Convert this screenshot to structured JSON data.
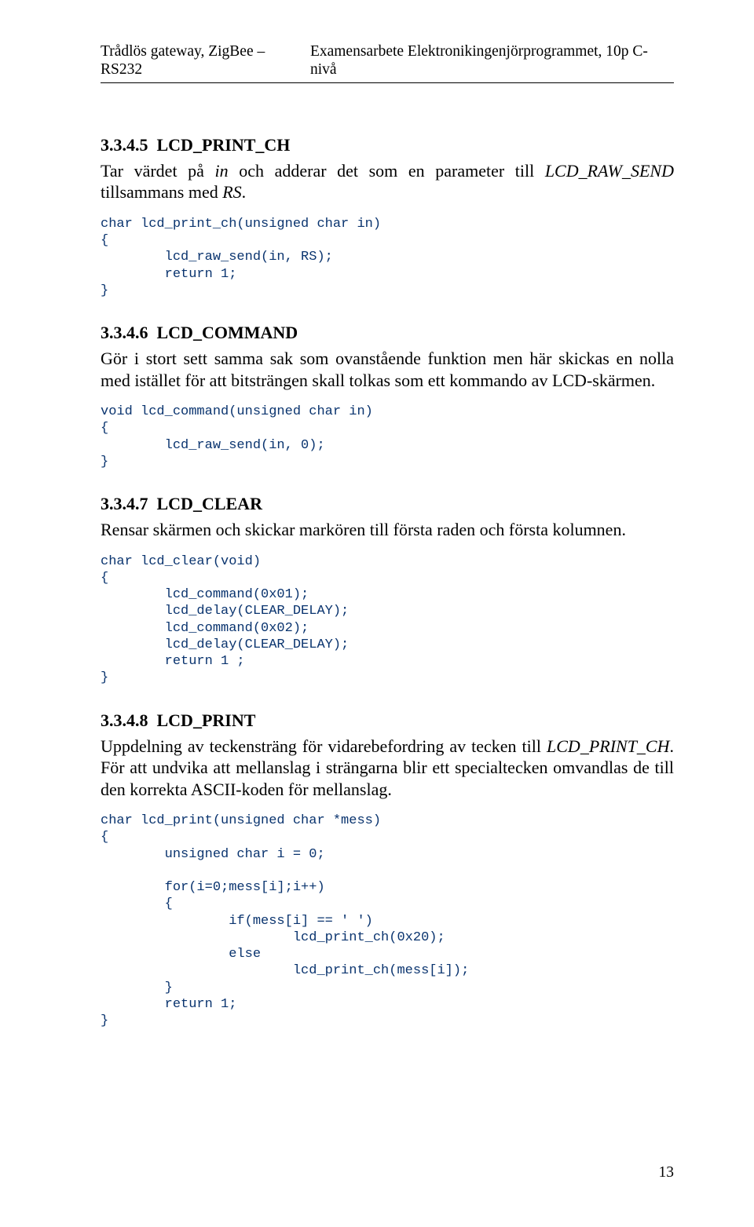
{
  "header": {
    "left": "Trådlös gateway, ZigBee – RS232",
    "right": "Examensarbete Elektronikingenjörprogrammet, 10p C-nivå"
  },
  "sections": [
    {
      "number": "3.3.4.5",
      "title": "LCD_PRINT_CH",
      "para_html": "Tar värdet på <i>in</i> och adderar det som en parameter till <i>LCD_RAW_SEND</i> tillsammans med <i>RS</i>.",
      "code": "char lcd_print_ch(unsigned char in)\n{\n        lcd_raw_send(in, RS);\n        return 1;\n}"
    },
    {
      "number": "3.3.4.6",
      "title": "LCD_COMMAND",
      "para_html": "Gör i stort sett samma sak som ovanstående funktion men här skickas en nolla med istället för att bitsträngen skall tolkas som ett kommando av LCD-skärmen.",
      "code": "void lcd_command(unsigned char in)\n{\n        lcd_raw_send(in, 0);\n}"
    },
    {
      "number": "3.3.4.7",
      "title": "LCD_CLEAR",
      "para_html": "Rensar skärmen och skickar markören till första raden och första kolumnen.",
      "code": "char lcd_clear(void)\n{\n        lcd_command(0x01);\n        lcd_delay(CLEAR_DELAY);\n        lcd_command(0x02);\n        lcd_delay(CLEAR_DELAY);\n        return 1 ;\n}"
    },
    {
      "number": "3.3.4.8",
      "title": "LCD_PRINT",
      "para_html": "Uppdelning av teckensträng för vidarebefordring av tecken till <i>LCD_PRINT_CH</i>. För att undvika att mellanslag i strängarna blir ett specialtecken omvandlas de till den korrekta ASCII-koden för mellanslag.",
      "code": "char lcd_print(unsigned char *mess)\n{\n        unsigned char i = 0;\n\n        for(i=0;mess[i];i++)\n        {\n                if(mess[i] == ' ')\n                        lcd_print_ch(0x20);\n                else\n                        lcd_print_ch(mess[i]);\n        }\n        return 1;\n}"
    }
  ],
  "page_number": "13"
}
